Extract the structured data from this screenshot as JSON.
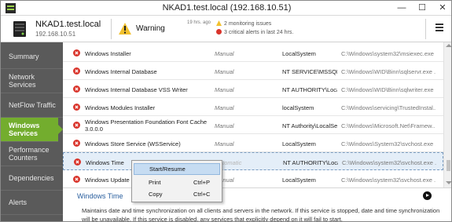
{
  "window": {
    "title": "NKAD1.test.local (192.168.10.51)",
    "minimize": "—",
    "maximize": "☐",
    "close": "✕"
  },
  "header": {
    "hostname": "NKAD1.test.local",
    "ip": "192.168.10.51",
    "status_label": "Warning",
    "time_ago": "19 hrs. ago",
    "issues": [
      "2 monitoring issues",
      "3 critical alerts in last 24 hrs."
    ]
  },
  "sidebar": {
    "items": [
      "Summary",
      "Network Services",
      "NetFlow Traffic",
      "Windows Services",
      "Performance Counters",
      "Dependencies",
      "Alerts"
    ],
    "active": "Windows Services"
  },
  "services": {
    "rows": [
      {
        "name": "Windows Installer",
        "start": "Manual",
        "account": "LocalSystem",
        "path": "C:\\Windows\\system32\\msiexec.exe /V"
      },
      {
        "name": "Windows Internal Database",
        "start": "Manual",
        "account": "NT SERVICE\\MSSQLS...",
        "path": "C:\\Windows\\WID\\Binn\\sqlservr.exe ..."
      },
      {
        "name": "Windows Internal Database VSS Writer",
        "start": "Manual",
        "account": "NT AUTHORITY\\LocalS...",
        "path": "C:\\Windows\\WID\\Binn\\sqlwriter.exe"
      },
      {
        "name": "Windows Modules Installer",
        "start": "Manual",
        "account": "localSystem",
        "path": "C:\\Windows\\servicing\\TrustedInstal..."
      },
      {
        "name": "Windows Presentation Foundation Font Cache 3.0.0.0",
        "start": "Manual",
        "account": "NT Authority\\LocalSer...",
        "path": "C:\\Windows\\Microsoft.Net\\Framew..."
      },
      {
        "name": "Windows Store Service (WSService)",
        "start": "Manual",
        "account": "LocalSystem",
        "path": "C:\\Windows\\System32\\svchost.exe ..."
      },
      {
        "name": "Windows Time",
        "start": "Automatic",
        "account": "NT AUTHORITY\\LocalS...",
        "path": "C:\\Windows\\system32\\svchost.exe ..."
      },
      {
        "name": "Windows Update",
        "start": "Manual",
        "account": "LocalSystem",
        "path": "C:\\Windows\\system32\\svchost.exe ..."
      }
    ]
  },
  "detail": {
    "title": "Windows Time",
    "description": "Maintains date and time synchronization on all clients and servers in the network. If this service is stopped, date and time synchronization will be unavailable. If this service is disabled, any services that explicitly depend on it will fail to start."
  },
  "context_menu": {
    "items": [
      {
        "label": "Start/Resume",
        "shortcut": ""
      },
      {
        "label": "Print",
        "shortcut": "Ctrl+P"
      },
      {
        "label": "Copy",
        "shortcut": "Ctrl+C"
      }
    ]
  },
  "colors": {
    "accent_green": "#73ad2e",
    "sidebar_bg": "#5a5a5a",
    "stopped_red": "#d9342b",
    "warning_yellow": "#f2c12e",
    "link_blue": "#2a5f9e"
  }
}
